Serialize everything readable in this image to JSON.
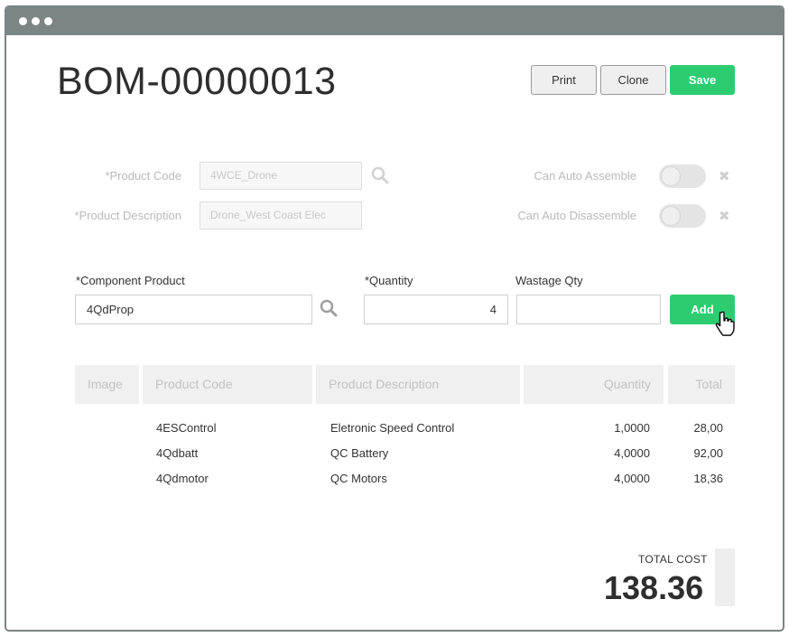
{
  "document": {
    "title": "BOM-00000013"
  },
  "toolbar": {
    "print_label": "Print",
    "clone_label": "Clone",
    "save_label": "Save"
  },
  "header_fields": {
    "product_code_label": "*Product Code",
    "product_code_value": "4WCE_Drone",
    "product_description_label": "*Product Description",
    "product_description_value": "Drone_West Coast Elec",
    "auto_assemble_label": "Can Auto Assemble",
    "auto_disassemble_label": "Can Auto Disassemble"
  },
  "component_form": {
    "component_label": "*Component Product",
    "component_value": "4QdProp",
    "quantity_label": "*Quantity",
    "quantity_value": "4",
    "wastage_label": "Wastage Qty",
    "wastage_value": "",
    "add_label": "Add"
  },
  "table": {
    "headers": [
      "Image",
      "Product Code",
      "Product Description",
      "Quantity",
      "Total"
    ],
    "rows": [
      {
        "code": "4ESControl",
        "description": "Eletronic Speed Control",
        "quantity": "1,0000",
        "total": "28,00"
      },
      {
        "code": "4Qdbatt",
        "description": "QC Battery",
        "quantity": "4,0000",
        "total": "92,00"
      },
      {
        "code": "4Qdmotor",
        "description": "QC Motors",
        "quantity": "4,0000",
        "total": "18,36"
      }
    ]
  },
  "summary": {
    "total_cost_label": "TOTAL COST",
    "total_cost_value": "138.36"
  },
  "colors": {
    "accent_green": "#2ecc71",
    "titlebar": "#7b8584"
  },
  "icons": {
    "search": "search-icon",
    "close": "close-icon",
    "cursor": "hand-pointer-icon"
  }
}
